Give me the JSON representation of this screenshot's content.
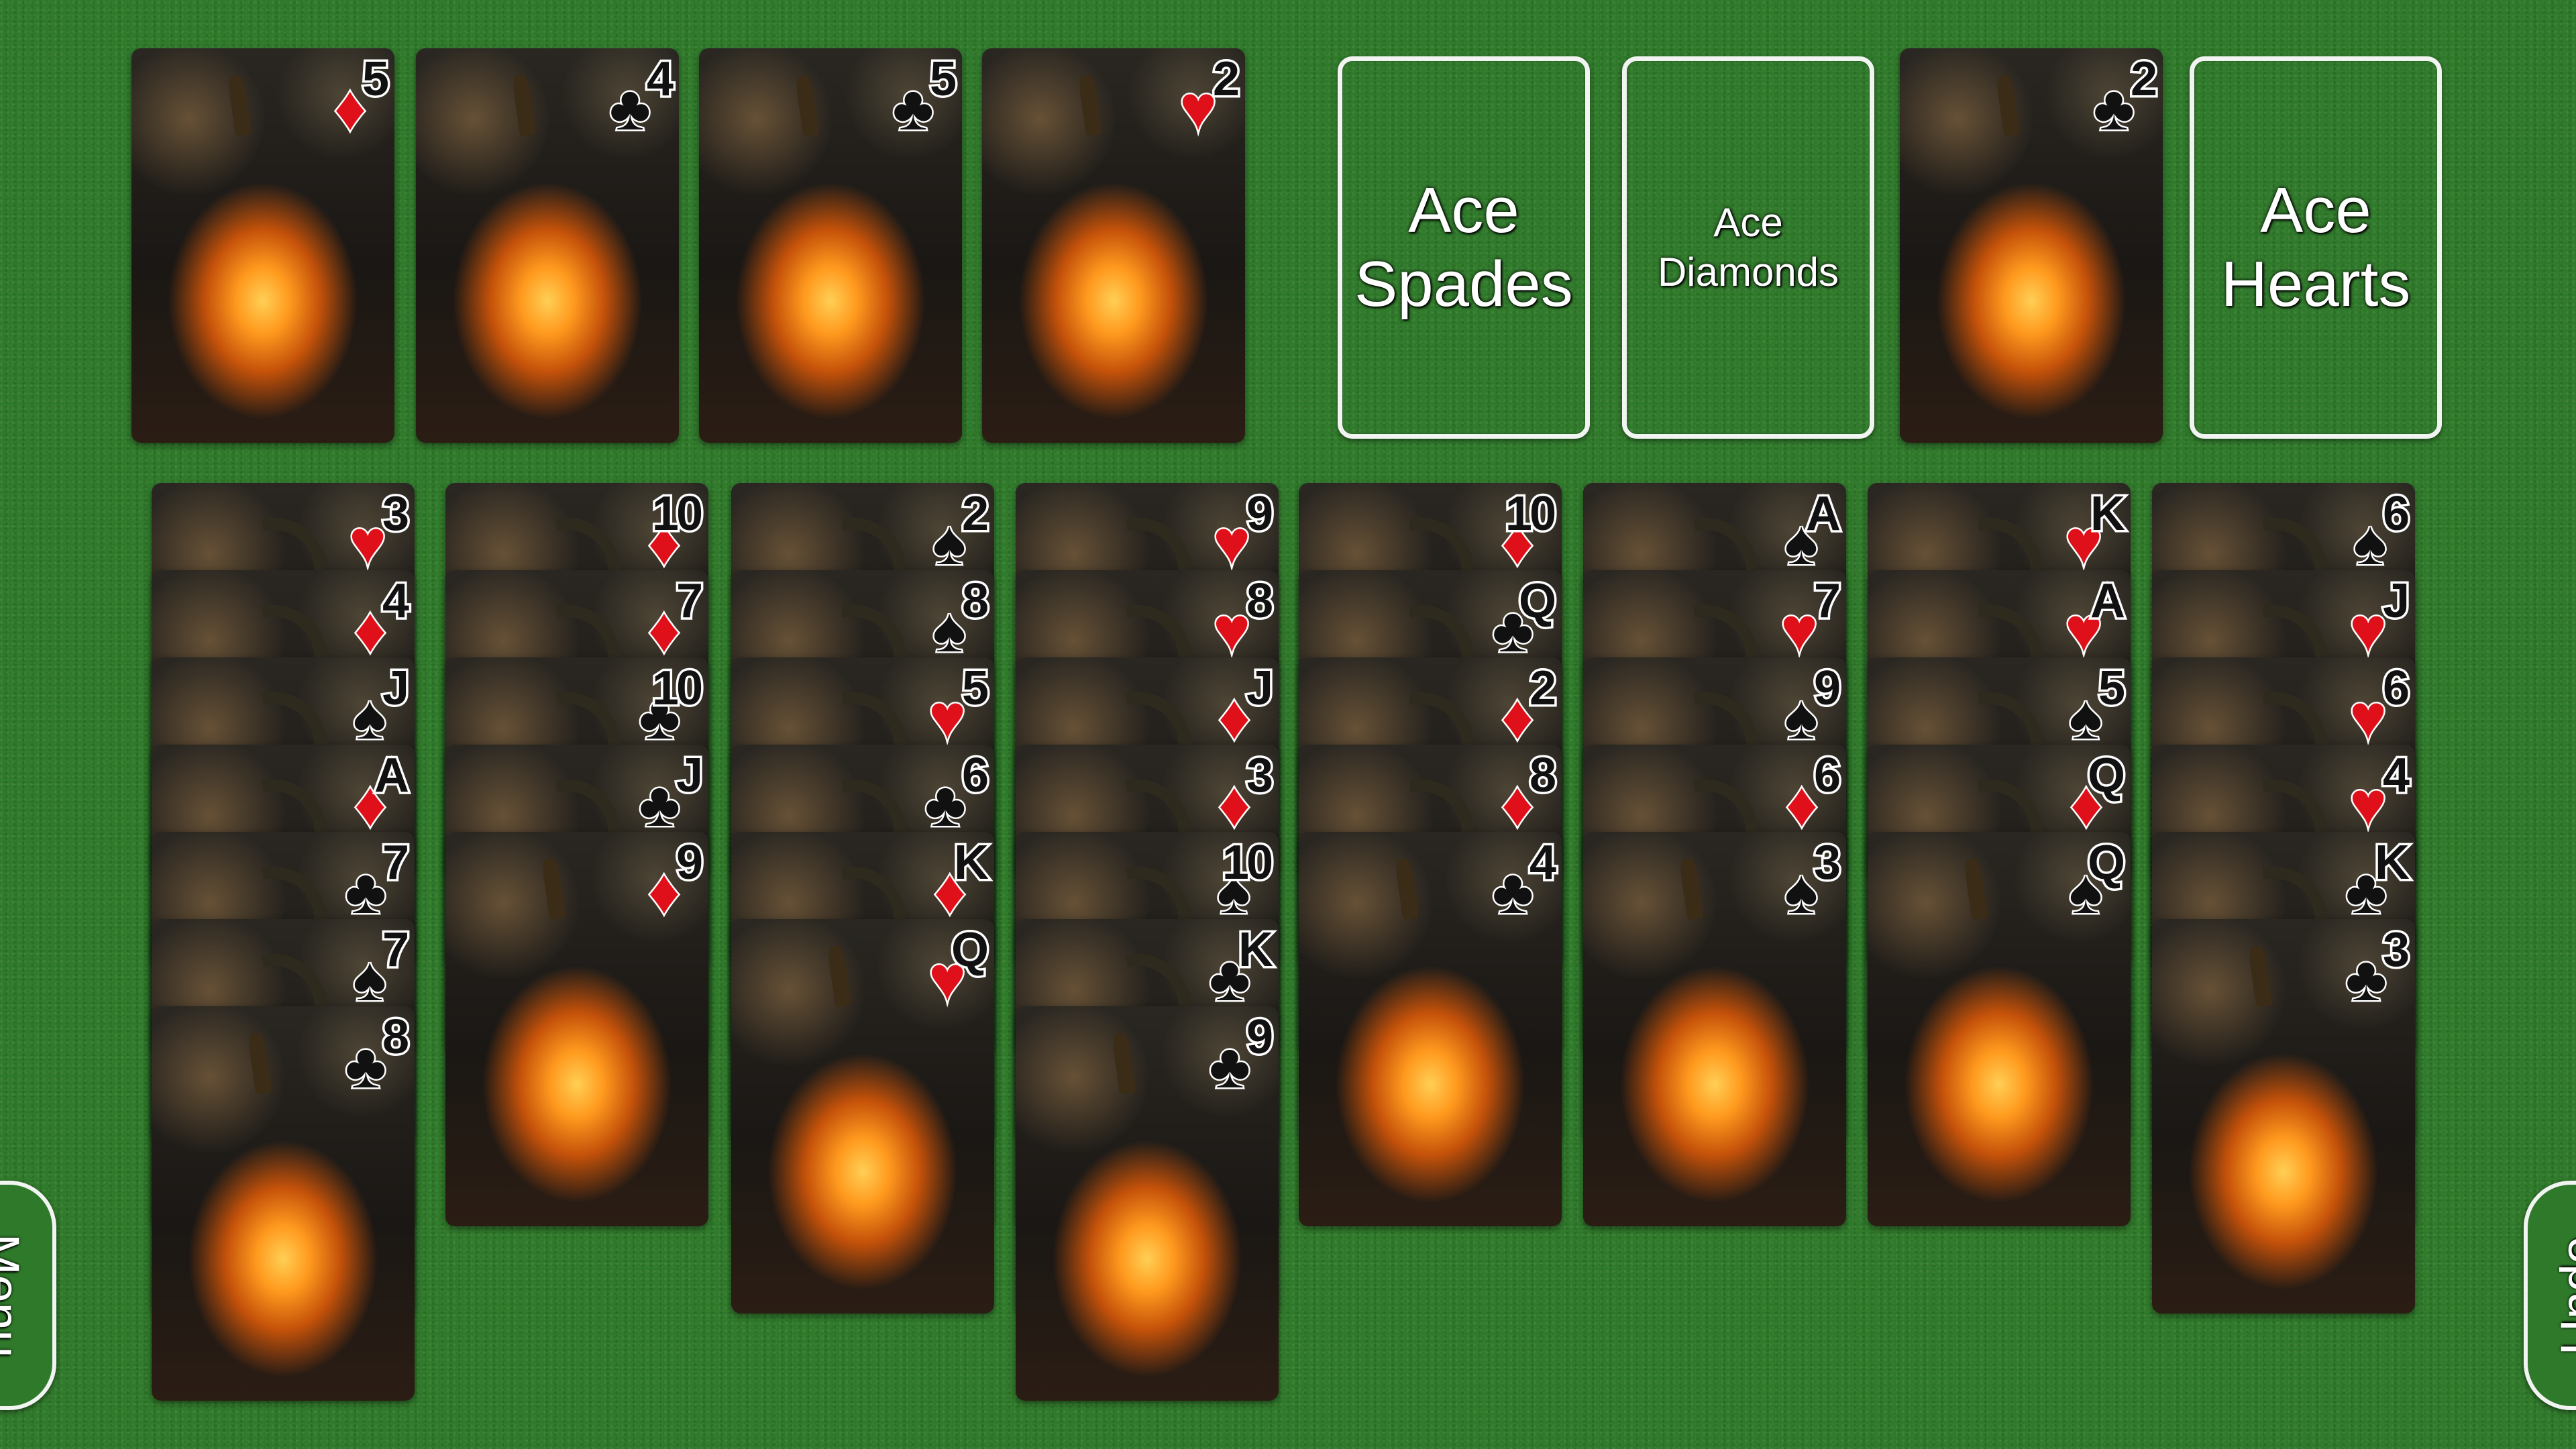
{
  "top_row": [
    {
      "rank": "5",
      "suit": "♦",
      "color": "red",
      "art": "skeleton"
    },
    {
      "rank": "4",
      "suit": "♣",
      "color": "black",
      "art": "witch-hands"
    },
    {
      "rank": "5",
      "suit": "♣",
      "color": "black",
      "art": "skull"
    },
    {
      "rank": "2",
      "suit": "♥",
      "color": "red",
      "art": "mummy"
    }
  ],
  "foundations": {
    "spades": [
      "Ace",
      "Spades"
    ],
    "diamonds": [
      "Ace",
      "Diamonds"
    ],
    "clubs_top": {
      "rank": "2",
      "suit": "♣",
      "color": "black",
      "art": "devil"
    },
    "hearts": [
      "Ace",
      "Hearts"
    ]
  },
  "tableau": [
    [
      {
        "r": "3",
        "s": "♥",
        "c": "red"
      },
      {
        "r": "4",
        "s": "♦",
        "c": "red"
      },
      {
        "r": "J",
        "s": "♠",
        "c": "black"
      },
      {
        "r": "A",
        "s": "♦",
        "c": "red"
      },
      {
        "r": "7",
        "s": "♣",
        "c": "black"
      },
      {
        "r": "7",
        "s": "♠",
        "c": "black"
      },
      {
        "r": "8",
        "s": "♣",
        "c": "black",
        "art": "witch-silhouette"
      }
    ],
    [
      {
        "r": "10",
        "s": "♦",
        "c": "red"
      },
      {
        "r": "7",
        "s": "♦",
        "c": "red"
      },
      {
        "r": "10",
        "s": "♣",
        "c": "black"
      },
      {
        "r": "J",
        "s": "♣",
        "c": "black"
      },
      {
        "r": "9",
        "s": "♦",
        "c": "red",
        "art": "witch-face"
      }
    ],
    [
      {
        "r": "2",
        "s": "♠",
        "c": "black"
      },
      {
        "r": "8",
        "s": "♠",
        "c": "black"
      },
      {
        "r": "5",
        "s": "♥",
        "c": "red"
      },
      {
        "r": "6",
        "s": "♣",
        "c": "black"
      },
      {
        "r": "K",
        "s": "♦",
        "c": "red"
      },
      {
        "r": "Q",
        "s": "♥",
        "c": "red",
        "art": "witch-hat"
      }
    ],
    [
      {
        "r": "9",
        "s": "♥",
        "c": "red"
      },
      {
        "r": "8",
        "s": "♥",
        "c": "red"
      },
      {
        "r": "J",
        "s": "♦",
        "c": "red"
      },
      {
        "r": "3",
        "s": "♦",
        "c": "red"
      },
      {
        "r": "10",
        "s": "♠",
        "c": "black"
      },
      {
        "r": "K",
        "s": "♣",
        "c": "black"
      },
      {
        "r": "9",
        "s": "♣",
        "c": "black",
        "art": "mummy"
      }
    ],
    [
      {
        "r": "10",
        "s": "♦",
        "c": "red"
      },
      {
        "r": "Q",
        "s": "♣",
        "c": "black"
      },
      {
        "r": "2",
        "s": "♦",
        "c": "red"
      },
      {
        "r": "8",
        "s": "♦",
        "c": "red"
      },
      {
        "r": "4",
        "s": "♣",
        "c": "black",
        "art": "vampire"
      }
    ],
    [
      {
        "r": "A",
        "s": "♠",
        "c": "black"
      },
      {
        "r": "7",
        "s": "♥",
        "c": "red"
      },
      {
        "r": "9",
        "s": "♠",
        "c": "black"
      },
      {
        "r": "6",
        "s": "♦",
        "c": "red"
      },
      {
        "r": "3",
        "s": "♠",
        "c": "black",
        "art": "demon"
      }
    ],
    [
      {
        "r": "K",
        "s": "♥",
        "c": "red"
      },
      {
        "r": "A",
        "s": "♥",
        "c": "red"
      },
      {
        "r": "5",
        "s": "♠",
        "c": "black"
      },
      {
        "r": "Q",
        "s": "♦",
        "c": "red"
      },
      {
        "r": "Q",
        "s": "♠",
        "c": "black",
        "art": "witch-woman"
      }
    ],
    [
      {
        "r": "6",
        "s": "♠",
        "c": "black"
      },
      {
        "r": "J",
        "s": "♥",
        "c": "red"
      },
      {
        "r": "6",
        "s": "♥",
        "c": "red"
      },
      {
        "r": "4",
        "s": "♥",
        "c": "red"
      },
      {
        "r": "K",
        "s": "♣",
        "c": "black"
      },
      {
        "r": "3",
        "s": "♣",
        "c": "black",
        "art": "zombie"
      }
    ]
  ],
  "buttons": {
    "menu": "Menu",
    "undo": "Undo"
  },
  "colors": {
    "felt": "#2f7a2a",
    "red": "#e0101a",
    "black": "#111111",
    "outline": "#f2f4f2"
  }
}
